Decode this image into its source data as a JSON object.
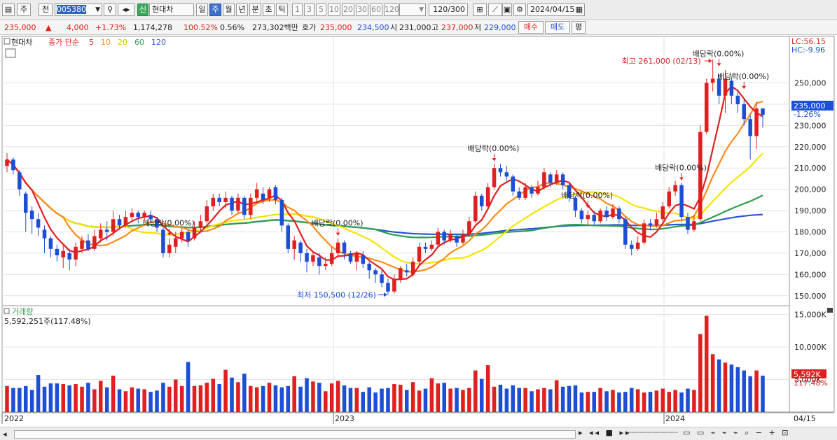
{
  "toolbar": {
    "period_prev": "주",
    "period_label": "전",
    "code": "005380",
    "market_badge": "신",
    "name": "현대차",
    "periods": [
      "일",
      "주",
      "월",
      "년",
      "분",
      "초",
      "틱"
    ],
    "periods_selected": 1,
    "nums": [
      "1",
      "3",
      "5",
      "10",
      "20",
      "30",
      "60",
      "120"
    ],
    "count": "120",
    "count_total": "/300",
    "date": "2024/04/15"
  },
  "quote": {
    "price": "235,000",
    "change": "4,000",
    "change_pct": "+1.73%",
    "volume": "1,174,278",
    "vol_ratio": "100.52%",
    "turnover_pct": "0.56%",
    "amount": "273,302백만",
    "ask_label": "호가",
    "ask": "235,000",
    "bid": "234,500",
    "open_label": "시",
    "open": "231,000",
    "high_label": "고",
    "high": "237,000",
    "low_label": "저",
    "low": "229,000",
    "buy": "매수",
    "sell": "매도",
    "eval": "평"
  },
  "legend": {
    "name": "현대차",
    "close_label": "종가 단순",
    "ma": [
      {
        "label": "5",
        "color": "#e02020"
      },
      {
        "label": "10",
        "color": "#ff8a1a"
      },
      {
        "label": "20",
        "color": "#f5e400"
      },
      {
        "label": "60",
        "color": "#2f9e4a"
      },
      {
        "label": "120",
        "color": "#2a56d8"
      }
    ]
  },
  "volume_legend": {
    "label": "거래량",
    "value": "5,592,251주(117.48%)"
  },
  "lc": "LC:56.15",
  "hc": "HC:-9.96",
  "current_price_label": "235,000",
  "current_price_pct": "-1.26%",
  "current_vol_label": "5,592K",
  "current_vol_pct": "117.48%",
  "annotations": {
    "high": "최고 261,000 (02/13)",
    "low": "최저 150,500 (12/26)",
    "dividend": "배당락(0.00%)"
  },
  "date_axis": {
    "y2022": "2022",
    "y2023": "2023",
    "y2024": "2024",
    "last": "04/15"
  },
  "colors": {
    "up": "#e02020",
    "down": "#1d4fd6"
  },
  "chart_data": {
    "type": "candlestick",
    "title": "",
    "price_ylim": [
      145000,
      262000
    ],
    "price_yticks": [
      150000,
      160000,
      170000,
      180000,
      190000,
      200000,
      210000,
      220000,
      230000,
      240000,
      250000
    ],
    "price_ytick_labels": [
      "150,000",
      "160,000",
      "170,000",
      "180,000",
      "190,000",
      "200,000",
      "210,000",
      "220,000",
      "230,000",
      "240,000",
      "250,000"
    ],
    "volume_ylim": [
      0,
      15500
    ],
    "volume_yticks": [
      5000,
      10000,
      15000
    ],
    "volume_ytick_labels": [
      "5,000K",
      "10,000K",
      "15,000K"
    ],
    "candles": [
      {
        "o": 211000,
        "c": 214000,
        "h": 217000,
        "l": 208000,
        "v": 4000
      },
      {
        "o": 214000,
        "c": 209000,
        "h": 215000,
        "l": 207000,
        "v": 3700
      },
      {
        "o": 208000,
        "c": 200000,
        "h": 209000,
        "l": 197000,
        "v": 3700
      },
      {
        "o": 198000,
        "c": 189000,
        "h": 199000,
        "l": 180000,
        "v": 4000
      },
      {
        "o": 190000,
        "c": 186000,
        "h": 192000,
        "l": 179000,
        "v": 3400
      },
      {
        "o": 186000,
        "c": 182000,
        "h": 189000,
        "l": 178000,
        "v": 5700
      },
      {
        "o": 181000,
        "c": 177000,
        "h": 183000,
        "l": 170000,
        "v": 3900
      },
      {
        "o": 177000,
        "c": 172000,
        "h": 178000,
        "l": 168000,
        "v": 4400
      },
      {
        "o": 172000,
        "c": 169000,
        "h": 174000,
        "l": 166000,
        "v": 4400
      },
      {
        "o": 168000,
        "c": 171000,
        "h": 174000,
        "l": 163000,
        "v": 4300
      },
      {
        "o": 170000,
        "c": 167000,
        "h": 172000,
        "l": 162000,
        "v": 4100
      },
      {
        "o": 167000,
        "c": 173000,
        "h": 175000,
        "l": 164000,
        "v": 4300
      },
      {
        "o": 172000,
        "c": 176000,
        "h": 178000,
        "l": 170000,
        "v": 3900
      },
      {
        "o": 176000,
        "c": 172000,
        "h": 179000,
        "l": 171000,
        "v": 4500
      },
      {
        "o": 172000,
        "c": 178000,
        "h": 181000,
        "l": 171000,
        "v": 3500
      },
      {
        "o": 177000,
        "c": 181000,
        "h": 184000,
        "l": 175000,
        "v": 4800
      },
      {
        "o": 181000,
        "c": 180000,
        "h": 185000,
        "l": 176000,
        "v": 3800
      },
      {
        "o": 180000,
        "c": 186000,
        "h": 190000,
        "l": 178000,
        "v": 5600
      },
      {
        "o": 186000,
        "c": 183000,
        "h": 188000,
        "l": 181000,
        "v": 3500
      },
      {
        "o": 183000,
        "c": 187000,
        "h": 190000,
        "l": 182000,
        "v": 3200
      },
      {
        "o": 187000,
        "c": 189000,
        "h": 191000,
        "l": 185000,
        "v": 3800
      },
      {
        "o": 189000,
        "c": 187000,
        "h": 190000,
        "l": 184000,
        "v": 3600
      },
      {
        "o": 187000,
        "c": 189000,
        "h": 190000,
        "l": 185000,
        "v": 3500
      },
      {
        "o": 188000,
        "c": 186000,
        "h": 190000,
        "l": 184000,
        "v": 3100
      },
      {
        "o": 186000,
        "c": 182000,
        "h": 187000,
        "l": 180000,
        "v": 3300
      },
      {
        "o": 181000,
        "c": 170000,
        "h": 182000,
        "l": 168000,
        "v": 4500
      },
      {
        "o": 170000,
        "c": 174000,
        "h": 177000,
        "l": 168000,
        "v": 3900
      },
      {
        "o": 173000,
        "c": 177000,
        "h": 180000,
        "l": 170000,
        "v": 5000
      },
      {
        "o": 177000,
        "c": 180000,
        "h": 182000,
        "l": 175000,
        "v": 4000
      },
      {
        "o": 180000,
        "c": 176000,
        "h": 181000,
        "l": 173000,
        "v": 7700
      },
      {
        "o": 177000,
        "c": 182000,
        "h": 185000,
        "l": 176000,
        "v": 4000
      },
      {
        "o": 182000,
        "c": 185000,
        "h": 188000,
        "l": 180000,
        "v": 4100
      },
      {
        "o": 185000,
        "c": 192000,
        "h": 195000,
        "l": 184000,
        "v": 4500
      },
      {
        "o": 192000,
        "c": 196000,
        "h": 198000,
        "l": 190000,
        "v": 5100
      },
      {
        "o": 196000,
        "c": 194000,
        "h": 198000,
        "l": 192000,
        "v": 4300
      },
      {
        "o": 194000,
        "c": 196000,
        "h": 199000,
        "l": 191000,
        "v": 6500
      },
      {
        "o": 196000,
        "c": 190000,
        "h": 197000,
        "l": 188000,
        "v": 5300
      },
      {
        "o": 190000,
        "c": 196000,
        "h": 198000,
        "l": 189000,
        "v": 4600
      },
      {
        "o": 196000,
        "c": 188000,
        "h": 197000,
        "l": 186000,
        "v": 5900
      },
      {
        "o": 188000,
        "c": 196000,
        "h": 198000,
        "l": 186000,
        "v": 4000
      },
      {
        "o": 196000,
        "c": 200000,
        "h": 203000,
        "l": 194000,
        "v": 3800
      },
      {
        "o": 198000,
        "c": 195000,
        "h": 201000,
        "l": 193000,
        "v": 4000
      },
      {
        "o": 196000,
        "c": 200000,
        "h": 201000,
        "l": 194000,
        "v": 4500
      },
      {
        "o": 201000,
        "c": 195000,
        "h": 202000,
        "l": 193000,
        "v": 4100
      },
      {
        "o": 195000,
        "c": 183000,
        "h": 196000,
        "l": 180000,
        "v": 3800
      },
      {
        "o": 183000,
        "c": 172000,
        "h": 184000,
        "l": 170000,
        "v": 4000
      },
      {
        "o": 172000,
        "c": 176000,
        "h": 178000,
        "l": 167000,
        "v": 5500
      },
      {
        "o": 175000,
        "c": 170000,
        "h": 176000,
        "l": 166000,
        "v": 3900
      },
      {
        "o": 170000,
        "c": 166000,
        "h": 172000,
        "l": 161000,
        "v": 5200
      },
      {
        "o": 166000,
        "c": 169000,
        "h": 171000,
        "l": 164000,
        "v": 4700
      },
      {
        "o": 168000,
        "c": 164000,
        "h": 170000,
        "l": 160000,
        "v": 4500
      },
      {
        "o": 164000,
        "c": 165000,
        "h": 168000,
        "l": 162000,
        "v": 3200
      },
      {
        "o": 165000,
        "c": 170000,
        "h": 173000,
        "l": 164000,
        "v": 4400
      },
      {
        "o": 170000,
        "c": 175000,
        "h": 177000,
        "l": 168000,
        "v": 4800
      },
      {
        "o": 175000,
        "c": 170000,
        "h": 176000,
        "l": 167000,
        "v": 4100
      },
      {
        "o": 170000,
        "c": 166000,
        "h": 171000,
        "l": 165000,
        "v": 3700
      },
      {
        "o": 166000,
        "c": 170000,
        "h": 171000,
        "l": 162000,
        "v": 3700
      },
      {
        "o": 169000,
        "c": 165000,
        "h": 171000,
        "l": 163000,
        "v": 3100
      },
      {
        "o": 165000,
        "c": 162000,
        "h": 166000,
        "l": 158000,
        "v": 3800
      },
      {
        "o": 162000,
        "c": 160000,
        "h": 163000,
        "l": 156000,
        "v": 3000
      },
      {
        "o": 160000,
        "c": 156000,
        "h": 162000,
        "l": 154000,
        "v": 3600
      },
      {
        "o": 156000,
        "c": 152000,
        "h": 158000,
        "l": 150500,
        "v": 3700
      },
      {
        "o": 152000,
        "c": 158000,
        "h": 160000,
        "l": 151000,
        "v": 4300
      },
      {
        "o": 158000,
        "c": 163000,
        "h": 164000,
        "l": 156000,
        "v": 4200
      },
      {
        "o": 162000,
        "c": 161000,
        "h": 165000,
        "l": 159000,
        "v": 3400
      },
      {
        "o": 160000,
        "c": 166000,
        "h": 168000,
        "l": 159000,
        "v": 4600
      },
      {
        "o": 166000,
        "c": 173000,
        "h": 175000,
        "l": 164000,
        "v": 3300
      },
      {
        "o": 173000,
        "c": 172000,
        "h": 175000,
        "l": 170000,
        "v": 3600
      },
      {
        "o": 172000,
        "c": 174000,
        "h": 176000,
        "l": 171000,
        "v": 5200
      },
      {
        "o": 174000,
        "c": 180000,
        "h": 182000,
        "l": 173000,
        "v": 4400
      },
      {
        "o": 180000,
        "c": 176000,
        "h": 181000,
        "l": 174000,
        "v": 4500
      },
      {
        "o": 176000,
        "c": 179000,
        "h": 181000,
        "l": 175000,
        "v": 3600
      },
      {
        "o": 178000,
        "c": 175000,
        "h": 179000,
        "l": 173000,
        "v": 3700
      },
      {
        "o": 175000,
        "c": 179000,
        "h": 181000,
        "l": 174000,
        "v": 3400
      },
      {
        "o": 179000,
        "c": 185000,
        "h": 187000,
        "l": 178000,
        "v": 3700
      },
      {
        "o": 185000,
        "c": 197000,
        "h": 199000,
        "l": 184000,
        "v": 6400
      },
      {
        "o": 197000,
        "c": 192000,
        "h": 198000,
        "l": 190000,
        "v": 5100
      },
      {
        "o": 192000,
        "c": 201000,
        "h": 203000,
        "l": 191000,
        "v": 7200
      },
      {
        "o": 201000,
        "c": 210000,
        "h": 212000,
        "l": 200000,
        "v": 3900
      },
      {
        "o": 210000,
        "c": 208000,
        "h": 212000,
        "l": 206000,
        "v": 4200
      },
      {
        "o": 208000,
        "c": 206000,
        "h": 211000,
        "l": 204000,
        "v": 3600
      },
      {
        "o": 206000,
        "c": 199000,
        "h": 207000,
        "l": 197000,
        "v": 4100
      },
      {
        "o": 199000,
        "c": 196000,
        "h": 201000,
        "l": 195000,
        "v": 3700
      },
      {
        "o": 196000,
        "c": 201000,
        "h": 203000,
        "l": 195000,
        "v": 3700
      },
      {
        "o": 201000,
        "c": 198000,
        "h": 202000,
        "l": 196000,
        "v": 3200
      },
      {
        "o": 198000,
        "c": 201000,
        "h": 204000,
        "l": 197000,
        "v": 3500
      },
      {
        "o": 201000,
        "c": 208000,
        "h": 210000,
        "l": 200000,
        "v": 3700
      },
      {
        "o": 207000,
        "c": 203000,
        "h": 208000,
        "l": 201000,
        "v": 3500
      },
      {
        "o": 203000,
        "c": 207000,
        "h": 209000,
        "l": 202000,
        "v": 4900
      },
      {
        "o": 207000,
        "c": 202000,
        "h": 208000,
        "l": 200000,
        "v": 3900
      },
      {
        "o": 202000,
        "c": 196000,
        "h": 203000,
        "l": 194000,
        "v": 4000
      },
      {
        "o": 196000,
        "c": 190000,
        "h": 197000,
        "l": 187000,
        "v": 4100
      },
      {
        "o": 190000,
        "c": 186000,
        "h": 191000,
        "l": 184000,
        "v": 3000
      },
      {
        "o": 186000,
        "c": 188000,
        "h": 190000,
        "l": 183000,
        "v": 3100
      },
      {
        "o": 188000,
        "c": 185000,
        "h": 190000,
        "l": 183000,
        "v": 3100
      },
      {
        "o": 185000,
        "c": 190000,
        "h": 191000,
        "l": 184000,
        "v": 3700
      },
      {
        "o": 190000,
        "c": 187000,
        "h": 192000,
        "l": 185000,
        "v": 3200
      },
      {
        "o": 187000,
        "c": 191000,
        "h": 193000,
        "l": 186000,
        "v": 3400
      },
      {
        "o": 191000,
        "c": 186000,
        "h": 192000,
        "l": 184000,
        "v": 3000
      },
      {
        "o": 186000,
        "c": 174000,
        "h": 187000,
        "l": 172000,
        "v": 3100
      },
      {
        "o": 174000,
        "c": 172000,
        "h": 176000,
        "l": 169000,
        "v": 3700
      },
      {
        "o": 172000,
        "c": 175000,
        "h": 178000,
        "l": 171000,
        "v": 3500
      },
      {
        "o": 175000,
        "c": 184000,
        "h": 186000,
        "l": 174000,
        "v": 3000
      },
      {
        "o": 184000,
        "c": 183000,
        "h": 186000,
        "l": 181000,
        "v": 3100
      },
      {
        "o": 183000,
        "c": 186000,
        "h": 189000,
        "l": 182000,
        "v": 3300
      },
      {
        "o": 186000,
        "c": 192000,
        "h": 194000,
        "l": 185000,
        "v": 3600
      },
      {
        "o": 192000,
        "c": 199000,
        "h": 201000,
        "l": 191000,
        "v": 3100
      },
      {
        "o": 199000,
        "c": 202000,
        "h": 204000,
        "l": 197000,
        "v": 3400
      },
      {
        "o": 202000,
        "c": 187000,
        "h": 203000,
        "l": 185000,
        "v": 3000
      },
      {
        "o": 187000,
        "c": 181000,
        "h": 189000,
        "l": 179000,
        "v": 3600
      },
      {
        "o": 181000,
        "c": 185000,
        "h": 188000,
        "l": 180000,
        "v": 3400
      },
      {
        "o": 186000,
        "c": 227000,
        "h": 230000,
        "l": 185000,
        "v": 12000
      },
      {
        "o": 227000,
        "c": 250000,
        "h": 252000,
        "l": 226000,
        "v": 14800
      },
      {
        "o": 250000,
        "c": 252000,
        "h": 261000,
        "l": 246000,
        "v": 8900
      },
      {
        "o": 252000,
        "c": 244000,
        "h": 254000,
        "l": 240000,
        "v": 8100
      },
      {
        "o": 244000,
        "c": 252000,
        "h": 256000,
        "l": 236000,
        "v": 7600
      },
      {
        "o": 251000,
        "c": 244000,
        "h": 253000,
        "l": 240000,
        "v": 7300
      },
      {
        "o": 244000,
        "c": 240000,
        "h": 246000,
        "l": 236000,
        "v": 6900
      },
      {
        "o": 240000,
        "c": 233000,
        "h": 242000,
        "l": 230000,
        "v": 6400
      },
      {
        "o": 233000,
        "c": 225000,
        "h": 235000,
        "l": 214000,
        "v": 5500
      },
      {
        "o": 225000,
        "c": 238000,
        "h": 241000,
        "l": 219000,
        "v": 6400
      },
      {
        "o": 238000,
        "c": 235000,
        "h": 237000,
        "l": 229000,
        "v": 5592
      }
    ]
  }
}
